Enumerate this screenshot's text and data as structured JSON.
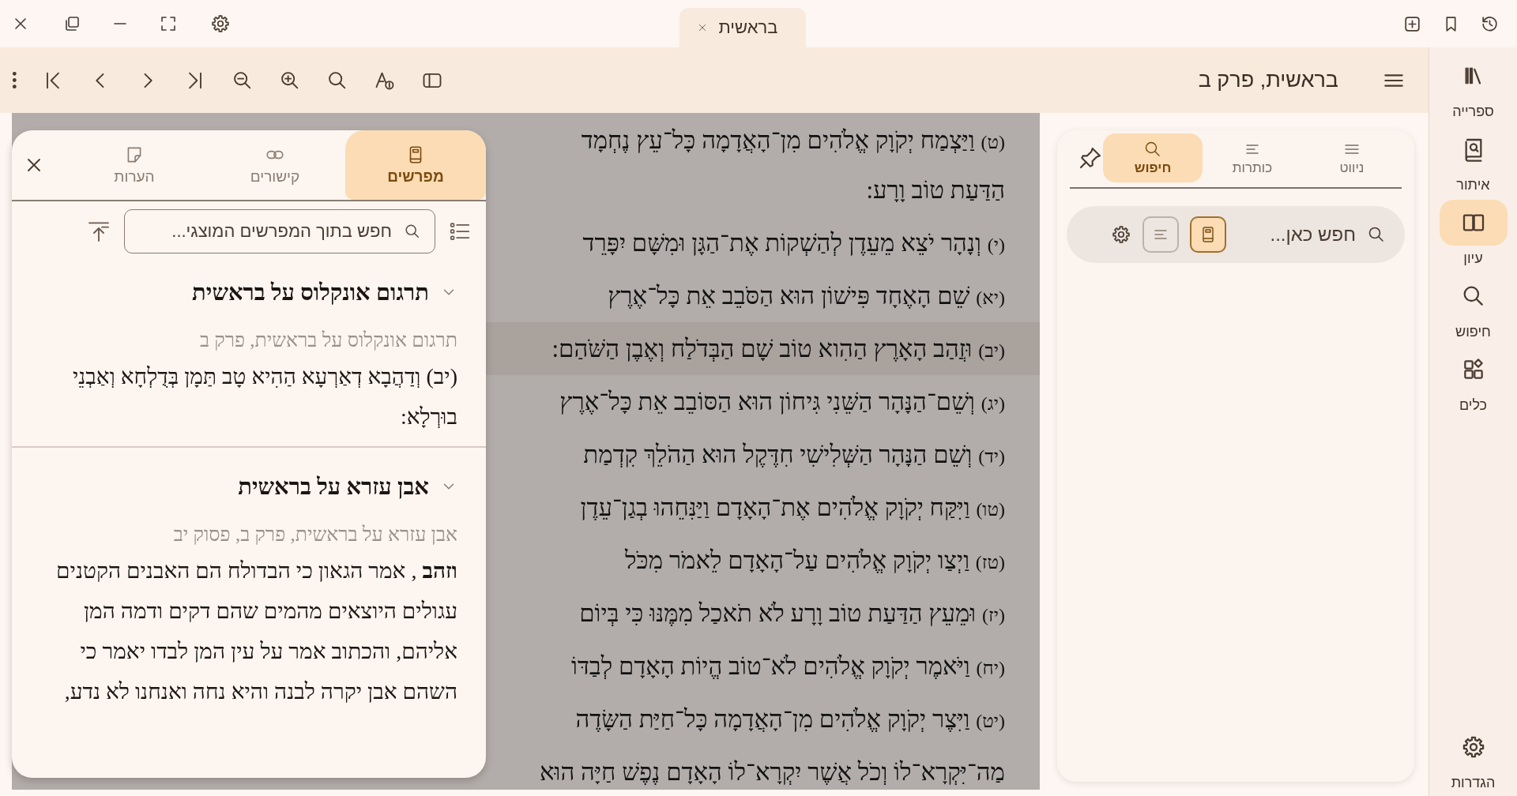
{
  "title_bar": {
    "tabs": [
      {
        "label": "בראשית",
        "selected": true
      }
    ]
  },
  "toolbar": {
    "title": "בראשית, פרק ב"
  },
  "rail": {
    "items": [
      {
        "label": "ספרייה",
        "kind": "library",
        "selected": false
      },
      {
        "label": "איתור",
        "kind": "find",
        "selected": false
      },
      {
        "label": "עיון",
        "kind": "study",
        "selected": true
      },
      {
        "label": "חיפוש",
        "kind": "search",
        "selected": false
      },
      {
        "label": "כלים",
        "kind": "tools",
        "selected": false
      },
      {
        "label": "הגדרות",
        "kind": "settings",
        "selected": false
      }
    ]
  },
  "nav_panel": {
    "tabs": [
      {
        "label": "ניווט",
        "kind": "menu",
        "selected": false
      },
      {
        "label": "כותרות",
        "kind": "headings",
        "selected": false
      },
      {
        "label": "חיפוש",
        "kind": "search",
        "selected": true
      }
    ],
    "search": {
      "placeholder": "חפש כאן...",
      "toggles": [
        {
          "kind": "book",
          "selected": true
        },
        {
          "kind": "lines",
          "selected": false
        }
      ]
    }
  },
  "reader": {
    "lines": [
      {
        "number": "(ט)",
        "text": "וַיַּצְמַח יְקֹוָק אֱלֹהִים מִן־הָאֲדָמָה כָּל־עֵץ נֶחְמָד",
        "selected": false
      },
      {
        "text": "הַדַּעַת טוֹב וָרָע:",
        "selected": false
      },
      {
        "number": "(י)",
        "text": "וְנָהָר יֹצֵא מֵעֵדֶן לְהַשְׁקוֹת אֶת־הַגָּן וּמִשָּׁם יִפָּרֵד",
        "selected": false
      },
      {
        "number": "(יא)",
        "text": "שֵׁם הָאֶחָד פִּישׁוֹן הוּא הַסֹּבֵב אֵת כָּל־אֶרֶץ",
        "selected": false
      },
      {
        "number": "(יב)",
        "text": "וּזֲהַב הָאָרֶץ הַהִוא טוֹב שָׁם הַבְּדֹלַח וְאֶבֶן הַשֹּׁהַם:",
        "selected": true
      },
      {
        "number": "(יג)",
        "text": "וְשֵׁם־הַנָּהָר הַשֵּׁנִי גִּיחוֹן הוּא הַסּוֹבֵב אֵת כָּל־אֶרֶץ",
        "selected": false
      },
      {
        "number": "(יד)",
        "text": "וְשֵׁם הַנָּהָר הַשְּׁלִישִׁי חִדֶּקֶל הוּא הַהֹלֵךְ קִדְמַת",
        "selected": false
      },
      {
        "number": "(טו)",
        "text": "וַיִּקַּח יְקֹוָק אֱלֹהִים אֶת־הָאָדָם וַיַּנִּחֵהוּ בְגַן־עֵדֶן",
        "selected": false
      },
      {
        "number": "(טז)",
        "text": "וַיְצַו יְקֹוָק אֱלֹהִים עַל־הָאָדָם לֵאמֹר מִכֹּל",
        "selected": false
      },
      {
        "number": "(יז)",
        "text": "וּמֵעֵץ הַדַּעַת טוֹב וָרָע לֹא תֹאכַל מִמֶּנּוּ כִּי בְּיוֹם",
        "selected": false
      },
      {
        "number": "(יח)",
        "text": "וַיֹּאמֶר יְקֹוָק אֱלֹהִים לֹא־טוֹב הֱיוֹת הָאָדָם לְבַדּוֹ",
        "selected": false
      },
      {
        "number": "(יט)",
        "text": "וַיִּצֶר יְקֹוָק אֱלֹהִים מִן־הָאֲדָמָה כָּל־חַיַּת הַשָּׂדֶה",
        "selected": false
      },
      {
        "text": "מַה־יִּקְרָא־לוֹ וְכֹל אֲשֶׁר יִקְרָא־לוֹ הָאָדָם נֶפֶשׁ חַיָּה הוּא",
        "selected": false
      }
    ]
  },
  "commentary_panel": {
    "tabs": [
      {
        "label": "מפרשים",
        "kind": "book",
        "selected": true
      },
      {
        "label": "קישורים",
        "kind": "link",
        "selected": false
      },
      {
        "label": "הערות",
        "kind": "note",
        "selected": false
      }
    ],
    "search": {
      "placeholder": "חפש בתוך המפרשים המוצגי..."
    },
    "groups": [
      {
        "title": "תרגום אונקלוס על בראשית",
        "expanded": true,
        "reference": "תרגום אונקלוס על בראשית, פרק ב",
        "text": "(יב) וְדַהֲבָא דְאַרְעָא הַהִיא טָב תַּמָן בְּדֻלְחָא וְאַבְנֵי בוּרְלָא:"
      },
      {
        "title": "אבן עזרא על בראשית",
        "expanded": true,
        "reference": "אבן עזרא על בראשית, פרק ב, פסוק יב",
        "text": "**וזהב** , אמר הגאון כי הבדולח הם האבנים הקטנים עגולים היוצאים מהמים שהם דקים ודמה המן אליהם, והכתוב אמר על עין המן לבדו יאמר כי השהם אבן יקרה לבנה והיא נחה ואנחנו לא נדע,"
      }
    ]
  }
}
